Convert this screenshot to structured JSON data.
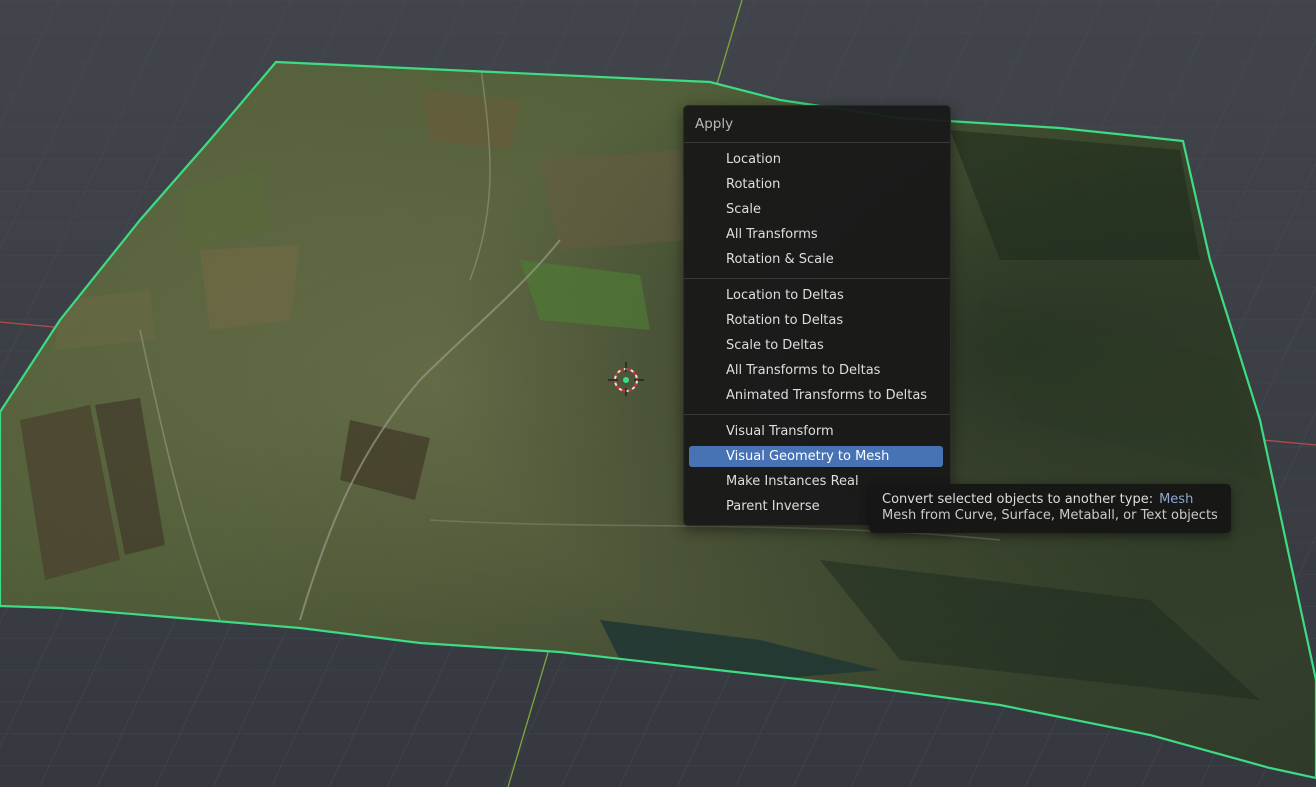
{
  "menu": {
    "title": "Apply",
    "groups": [
      {
        "items": [
          {
            "label": "Location"
          },
          {
            "label": "Rotation"
          },
          {
            "label": "Scale"
          },
          {
            "label": "All Transforms"
          },
          {
            "label": "Rotation & Scale"
          }
        ]
      },
      {
        "items": [
          {
            "label": "Location to Deltas"
          },
          {
            "label": "Rotation to Deltas"
          },
          {
            "label": "Scale to Deltas"
          },
          {
            "label": "All Transforms to Deltas"
          },
          {
            "label": "Animated Transforms to Deltas"
          }
        ]
      },
      {
        "items": [
          {
            "label": "Visual Transform"
          },
          {
            "label": "Visual Geometry to Mesh",
            "active": true
          },
          {
            "label": "Make Instances Real"
          },
          {
            "label": "Parent Inverse"
          }
        ]
      }
    ]
  },
  "tooltip": {
    "prefix": "Convert selected objects to another type:",
    "type": "Mesh",
    "description": "Mesh from Curve, Surface, Metaball, or Text objects"
  },
  "viewport": {
    "selection_outline_color": "#3ddc84",
    "highlight_color": "#4772b3",
    "x_axis_color": "#b54a4a",
    "y_axis_color": "#7fa83a"
  }
}
